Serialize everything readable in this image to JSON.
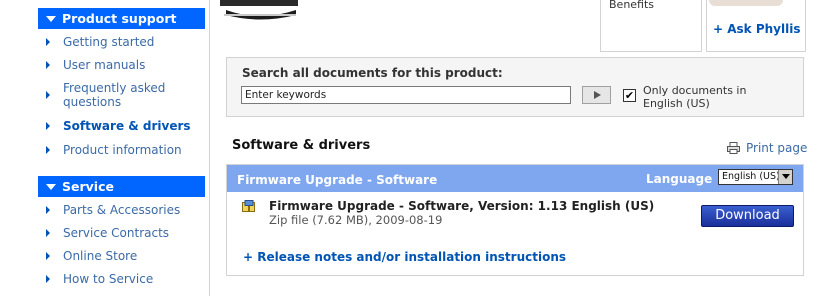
{
  "sidebar": {
    "product_support": {
      "heading": "Product support",
      "items": [
        {
          "label": "Getting started"
        },
        {
          "label": "User manuals"
        },
        {
          "label": "Frequently asked questions"
        },
        {
          "label": "Software & drivers"
        },
        {
          "label": "Product information"
        }
      ]
    },
    "service": {
      "heading": "Service",
      "items": [
        {
          "label": "Parts & Accessories"
        },
        {
          "label": "Service Contracts"
        },
        {
          "label": "Online Store"
        },
        {
          "label": "How to Service"
        }
      ]
    }
  },
  "top": {
    "benefits_label": "Benefits",
    "ask_phyllis": "+ Ask Phyllis"
  },
  "search": {
    "title": "Search all documents for this product:",
    "input_value": "Enter keywords",
    "only_english_label": "Only documents in English (US)",
    "only_english_checked": true
  },
  "software": {
    "title": "Software & drivers",
    "print_label": "Print page",
    "section_title": "Firmware Upgrade - Software",
    "language_label": "Language",
    "language_value": "English (US)",
    "file_name": "Firmware Upgrade - Software, Version: 1.13 English (US)",
    "file_meta": "Zip file (7.62 MB), 2009-08-19",
    "download_label": "Download",
    "release_notes": "+ Release notes and/or installation instructions"
  },
  "colors": {
    "accent": "#0066ff",
    "link": "#3b6aa6",
    "header_bar": "#7fa7f0",
    "download": "#1b2f9a"
  },
  "icons": [
    "chevron-right-icon",
    "play-icon",
    "checkbox-icon",
    "printer-icon",
    "zip-file-icon",
    "chevron-down-icon"
  ]
}
